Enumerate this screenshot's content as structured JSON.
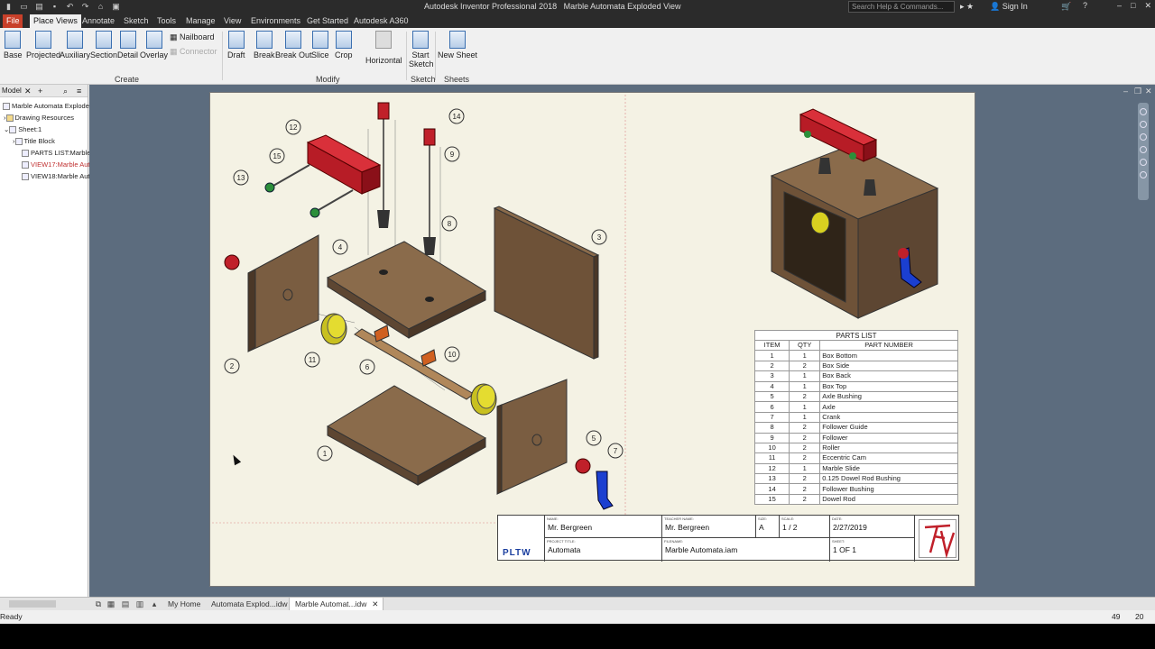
{
  "window": {
    "app_title": "Autodesk Inventor Professional 2018",
    "doc_title": "Marble Automata Exploded View",
    "search_placeholder": "Search Help & Commands...",
    "sign_in": "Sign In"
  },
  "tabs": [
    "File",
    "Place Views",
    "Annotate",
    "Sketch",
    "Tools",
    "Manage",
    "View",
    "Environments",
    "Get Started",
    "Autodesk A360"
  ],
  "active_tab": "Place Views",
  "ribbon": {
    "create": {
      "label": "Create",
      "buttons": [
        "Base",
        "Projected",
        "Auxiliary",
        "Section",
        "Detail",
        "Overlay"
      ],
      "small": [
        "Nailboard",
        "Connector"
      ]
    },
    "modify": {
      "label": "Modify",
      "buttons": [
        "Draft",
        "Break",
        "Break Out",
        "Slice",
        "Crop",
        "Horizontal"
      ]
    },
    "sketch": {
      "label": "Sketch",
      "button": "Start Sketch"
    },
    "sheets": {
      "label": "Sheets",
      "button": "New Sheet"
    }
  },
  "browser": {
    "header": "Model",
    "nodes": [
      "Marble Automata Explode",
      "Drawing Resources",
      "Sheet:1",
      "Title Block",
      "PARTS LIST:Marble",
      "VIEW17:Marble Aut",
      "VIEW18:Marble Aut"
    ]
  },
  "parts_list": {
    "caption": "PARTS LIST",
    "headers": [
      "ITEM",
      "QTY",
      "PART NUMBER"
    ],
    "rows": [
      [
        "1",
        "1",
        "Box Bottom"
      ],
      [
        "2",
        "2",
        "Box Side"
      ],
      [
        "3",
        "1",
        "Box Back"
      ],
      [
        "4",
        "1",
        "Box Top"
      ],
      [
        "5",
        "2",
        "Axle Bushing"
      ],
      [
        "6",
        "1",
        "Axle"
      ],
      [
        "7",
        "1",
        "Crank"
      ],
      [
        "8",
        "2",
        "Follower Guide"
      ],
      [
        "9",
        "2",
        "Follower"
      ],
      [
        "10",
        "2",
        "Roller"
      ],
      [
        "11",
        "2",
        "Eccentric Cam"
      ],
      [
        "12",
        "1",
        "Marble Slide"
      ],
      [
        "13",
        "2",
        "0.125 Dowel Rod Bushing"
      ],
      [
        "14",
        "2",
        "Follower Bushing"
      ],
      [
        "15",
        "2",
        "Dowel Rod"
      ]
    ]
  },
  "balloons": [
    "12",
    "14",
    "15",
    "9",
    "13",
    "8",
    "3",
    "4",
    "2",
    "11",
    "6",
    "10",
    "1",
    "5",
    "7"
  ],
  "title_block": {
    "name_cap": "Name:",
    "name": "Mr. Bergreen",
    "project_cap": "Project Title:",
    "project": "Automata",
    "teacher_cap": "Teacher Name:",
    "teacher": "Mr. Bergreen",
    "filename_cap": "Filename:",
    "filename": "Marble Automata.iam",
    "size_cap": "Size:",
    "size": "A",
    "scale_cap": "Scale:",
    "scale": "1 / 2",
    "date_cap": "Date:",
    "date": "2/27/2019",
    "sheet_cap": "Sheet:",
    "sheet": "1 OF 1",
    "logo_text": "PLTW"
  },
  "doc_tabs": [
    "My Home",
    "Automata Explod...idw",
    "Marble Automat...idw"
  ],
  "status": {
    "text": "Ready",
    "n1": "49",
    "n2": "20"
  }
}
